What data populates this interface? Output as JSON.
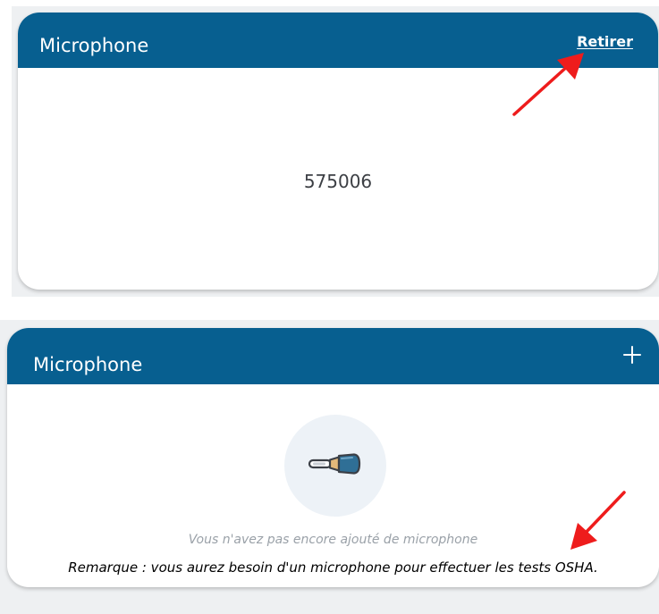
{
  "card_saved": {
    "title": "Microphone",
    "remove_label": "Retirer",
    "microphone_id": "575006"
  },
  "card_empty": {
    "title": "Microphone",
    "add_icon": "plus-icon",
    "empty_icon": "microphone-icon",
    "empty_message": "Vous n'avez pas encore ajouté de microphone",
    "note": "Remarque : vous aurez besoin d'un microphone pour effectuer les tests OSHA."
  },
  "annotations": {
    "arrow_color": "#ee1c1c"
  },
  "colors": {
    "header_blue": "#075f90",
    "empty_circle": "#edf2f7",
    "muted_text": "#9aa1a8"
  }
}
